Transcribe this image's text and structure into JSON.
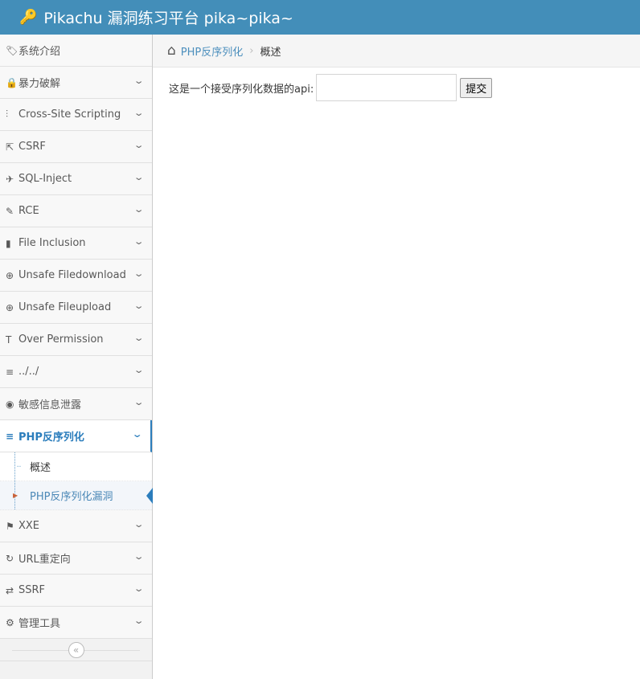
{
  "header": {
    "title": "Pikachu 漏洞练习平台 pika~pika~"
  },
  "sidebar": {
    "items": [
      {
        "label": "系统介绍",
        "icon": "🏷"
      },
      {
        "label": "暴力破解",
        "icon": "🔒"
      },
      {
        "label": "Cross-Site Scripting",
        "icon": "⫶"
      },
      {
        "label": "CSRF",
        "icon": "⇱"
      },
      {
        "label": "SQL-Inject",
        "icon": "✈"
      },
      {
        "label": "RCE",
        "icon": "✎"
      },
      {
        "label": "File Inclusion",
        "icon": "▮"
      },
      {
        "label": "Unsafe Filedownload",
        "icon": "⊕"
      },
      {
        "label": "Unsafe Fileupload",
        "icon": "⊕"
      },
      {
        "label": "Over Permission",
        "icon": "T"
      },
      {
        "label": "../../",
        "icon": "≡"
      },
      {
        "label": "敏感信息泄露",
        "icon": "◉"
      },
      {
        "label": "PHP反序列化",
        "icon": "≡"
      },
      {
        "label": "XXE",
        "icon": "⚑"
      },
      {
        "label": "URL重定向",
        "icon": "↻"
      },
      {
        "label": "SSRF",
        "icon": "⇄"
      },
      {
        "label": "管理工具",
        "icon": "⚙"
      }
    ],
    "sub": [
      "概述",
      "PHP反序列化漏洞"
    ]
  },
  "breadcrumb": {
    "parent": "PHP反序列化",
    "current": "概述"
  },
  "main": {
    "label": "这是一个接受序列化数据的api:",
    "input_value": "",
    "submit": "提交"
  }
}
